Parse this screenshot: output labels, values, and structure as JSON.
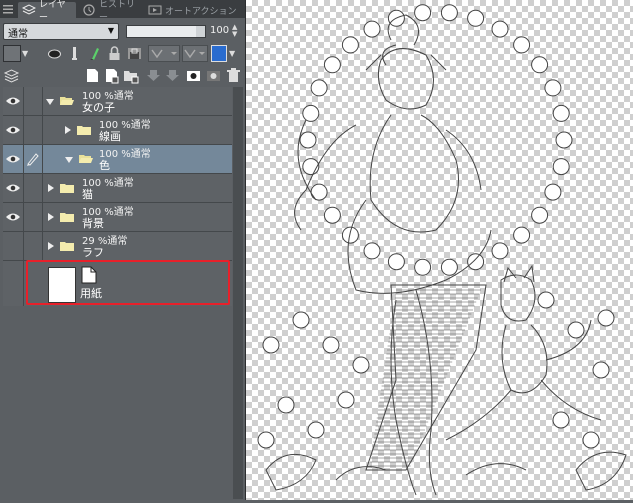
{
  "tabs": [
    {
      "label": "レイヤー",
      "icon": "layer-tab-icon"
    },
    {
      "label": "ヒストリー",
      "icon": "history-tab-icon"
    },
    {
      "label": "オートアクション",
      "icon": "auto-action-tab-icon"
    }
  ],
  "blend_mode": {
    "value": "通常"
  },
  "opacity": {
    "value": "100",
    "level": 0.88
  },
  "layers": [
    {
      "percent_mode": "100 %通常",
      "name": "女の子",
      "visible": true,
      "pen": false,
      "expanded": true,
      "indent": 0,
      "selected": false
    },
    {
      "percent_mode": "100 %通常",
      "name": "線画",
      "visible": true,
      "pen": false,
      "expanded": false,
      "indent": 1,
      "selected": false
    },
    {
      "percent_mode": "100 %通常",
      "name": "色",
      "visible": true,
      "pen": true,
      "expanded": true,
      "indent": 1,
      "selected": true
    },
    {
      "percent_mode": "100 %通常",
      "name": "猫",
      "visible": true,
      "pen": false,
      "expanded": false,
      "indent": 0,
      "selected": false
    },
    {
      "percent_mode": "100 %通常",
      "name": "背景",
      "visible": true,
      "pen": false,
      "expanded": false,
      "indent": 0,
      "selected": false
    },
    {
      "percent_mode": "29 %通常",
      "name": "ラフ",
      "visible": false,
      "pen": false,
      "expanded": false,
      "indent": 0,
      "selected": false
    }
  ],
  "paper_layer": {
    "name": "用紙"
  },
  "colors": {
    "selection": "#74889a",
    "highlight": "#e8202a"
  }
}
